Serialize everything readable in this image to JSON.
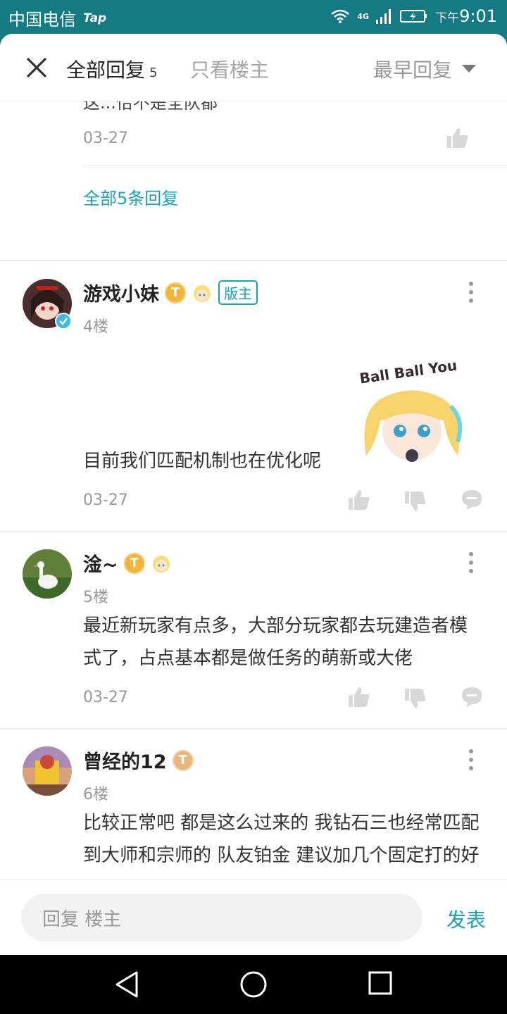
{
  "status_bar": {
    "carrier": "中国电信",
    "app_badge": "Tap",
    "network": "4G",
    "time_prefix": "下午",
    "time": "9:01"
  },
  "header": {
    "tab_all_label": "全部回复",
    "tab_all_count": "5",
    "tab_owner_label": "只看楼主",
    "sort_label": "最早回复"
  },
  "prev_reply": {
    "tail_text": "这...恰不是全队都",
    "date": "03-27",
    "all_replies_link": "全部5条回复"
  },
  "posts": [
    {
      "name": "游戏小妹",
      "level_badge": "T",
      "mod_badge": "版主",
      "floor": "4楼",
      "content": "目前我们匹配机制也在优化呢",
      "sticker_text": "Ball Ball You",
      "date": "03-27"
    },
    {
      "name": "淦~",
      "level_badge": "T",
      "floor": "5楼",
      "content": "最近新玩家有点多，大部分玩家都去玩建造者模式了，占点基本都是做任务的萌新或大佬",
      "date": "03-27"
    },
    {
      "name": "曾经的12",
      "level_badge": "T",
      "floor": "6楼",
      "content": "比较正常吧 都是这么过来的 我钻石三也经常匹配到大师和宗师的 队友铂金 建议加几个固定打的好友"
    }
  ],
  "reply_bar": {
    "placeholder": "回复  楼主",
    "publish_label": "发表"
  },
  "icons": {
    "close": "close-icon",
    "sort_arrow": "caret-down-icon",
    "like": "thumbs-up-icon",
    "dislike": "thumbs-down-icon",
    "comment": "comment-icon",
    "more": "more-vertical-icon"
  },
  "colors": {
    "accent": "#17a2b8",
    "status_bar": "#147a84",
    "badge_gold": "#f3b33d"
  }
}
